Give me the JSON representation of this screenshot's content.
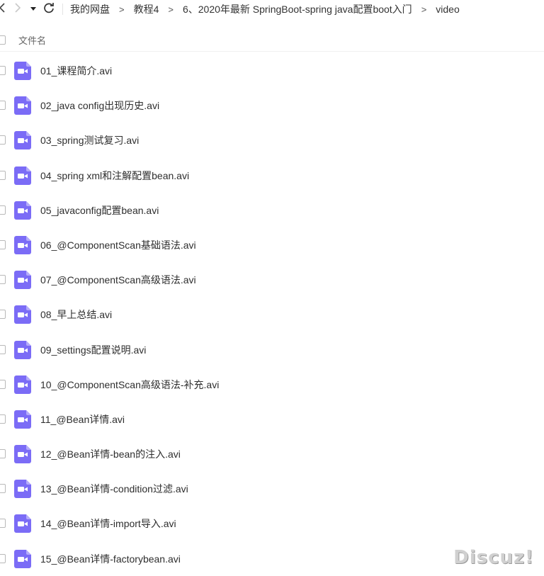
{
  "toolbar": {
    "back_icon": "chevron-left-icon",
    "forward_icon": "chevron-right-icon",
    "dropdown_icon": "caret-down-icon",
    "refresh_icon": "refresh-icon",
    "breadcrumbs": [
      "我的网盘",
      "教程4",
      "6、2020年最新 SpringBoot-spring java配置boot入门",
      "video"
    ],
    "separator": ">"
  },
  "header": {
    "name_column": "文件名"
  },
  "files": [
    {
      "name": "01_课程简介.avi"
    },
    {
      "name": "02_java config出现历史.avi"
    },
    {
      "name": "03_spring测试复习.avi"
    },
    {
      "name": "04_spring xml和注解配置bean.avi"
    },
    {
      "name": "05_javaconfig配置bean.avi"
    },
    {
      "name": "06_@ComponentScan基础语法.avi"
    },
    {
      "name": "07_@ComponentScan高级语法.avi"
    },
    {
      "name": "08_早上总结.avi"
    },
    {
      "name": "09_settings配置说明.avi"
    },
    {
      "name": "10_@ComponentScan高级语法-补充.avi"
    },
    {
      "name": "11_@Bean详情.avi"
    },
    {
      "name": "12_@Bean详情-bean的注入.avi"
    },
    {
      "name": "13_@Bean详情-condition过滤.avi"
    },
    {
      "name": "14_@Bean详情-import导入.avi"
    },
    {
      "name": "15_@Bean详情-factorybean.avi"
    }
  ],
  "colors": {
    "video_icon": "#7b6cf6",
    "video_icon_fold": "#b4abfa"
  },
  "watermark": "Discuz!"
}
